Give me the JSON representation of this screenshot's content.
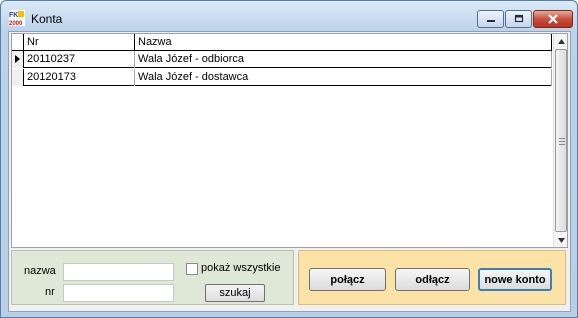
{
  "window": {
    "title": "Konta",
    "icon": "fk2000-app-icon"
  },
  "grid": {
    "columns": [
      "Nr",
      "Nazwa"
    ],
    "rows": [
      {
        "nr": "20110237",
        "nazwa": "Wala Józef - odbiorca",
        "current": true
      },
      {
        "nr": "20120173",
        "nazwa": "Wala Józef - dostawca",
        "current": false
      }
    ]
  },
  "filter": {
    "nazwa_label": "nazwa",
    "nazwa_value": "",
    "nr_label": "nr",
    "nr_value": "",
    "show_all_label": "pokaż wszystkie",
    "show_all_checked": false,
    "search_label": "szukaj"
  },
  "actions": {
    "connect_label": "połącz",
    "disconnect_label": "odłącz",
    "new_account_label": "nowe konto"
  },
  "colors": {
    "filter_panel_bg": "#dfe7d6",
    "action_panel_bg": "#fbe3a8",
    "default_button_border": "#3c7fb1"
  }
}
